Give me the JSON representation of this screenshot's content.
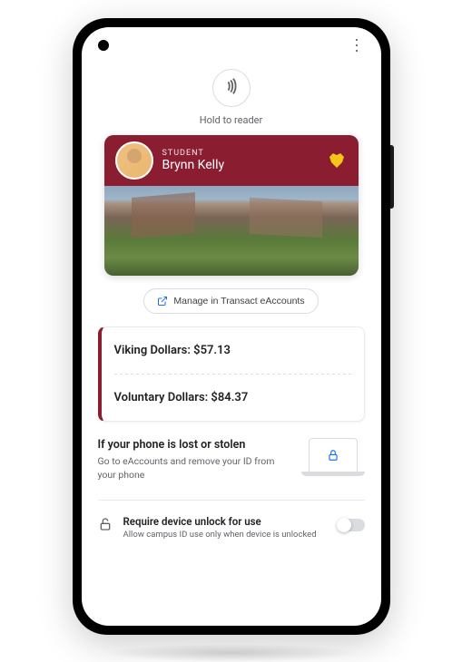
{
  "nfc": {
    "label": "Hold to reader"
  },
  "card": {
    "role": "STUDENT",
    "name": "Brynn Kelly"
  },
  "manage": {
    "label": "Manage in Transact eAccounts"
  },
  "balances": {
    "row1": "Viking Dollars: $57.13",
    "row2": "Voluntary Dollars: $84.37"
  },
  "lost_phone": {
    "title": "If your phone is lost or stolen",
    "desc": "Go to eAccounts and remove your ID from your phone"
  },
  "unlock": {
    "title": "Require device unlock for use",
    "desc": "Allow campus ID use only when device is unlocked"
  },
  "colors": {
    "card_primary": "#8a1d30",
    "link_blue": "#1a73e8"
  }
}
